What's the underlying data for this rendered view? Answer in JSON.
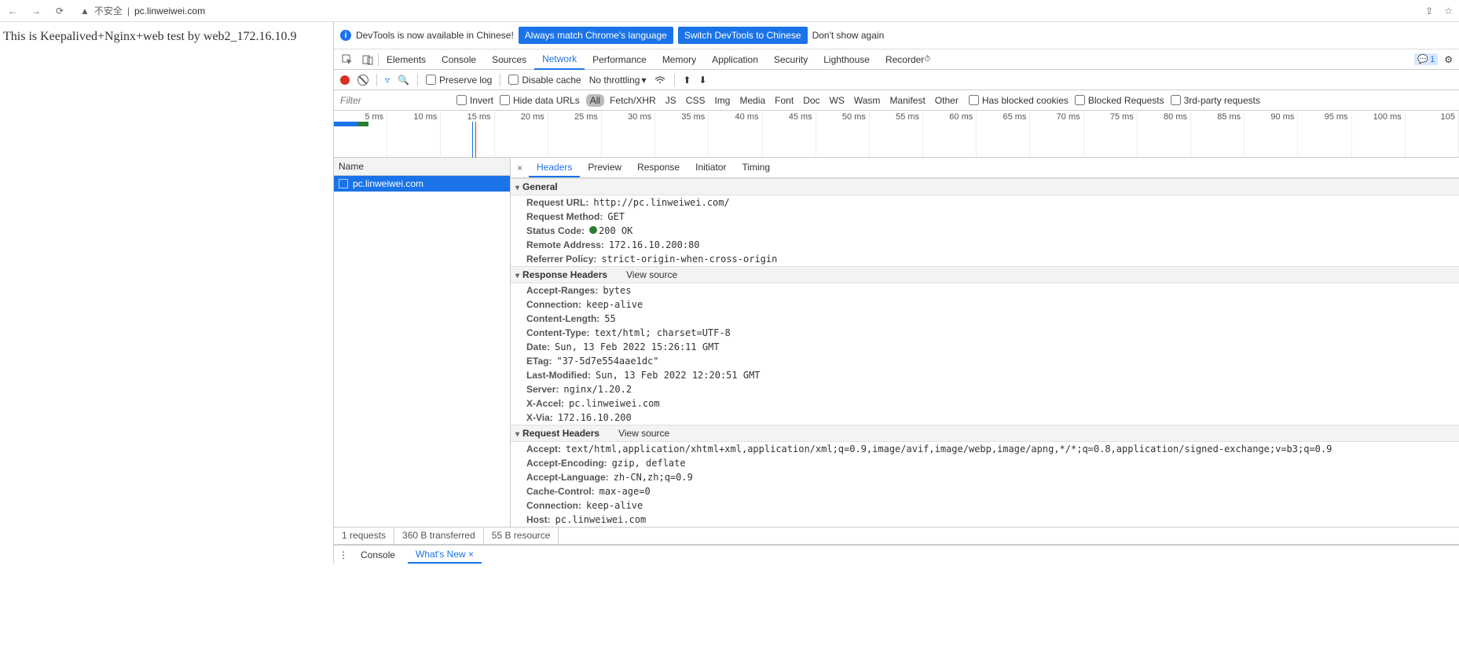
{
  "browser": {
    "insecure_label": "不安全",
    "url_display": "pc.linweiwei.com"
  },
  "page_content": "This is Keepalived+Nginx+web test by web2_172.16.10.9",
  "infobar": {
    "text": "DevTools is now available in Chinese!",
    "btn1": "Always match Chrome's language",
    "btn2": "Switch DevTools to Chinese",
    "link": "Don't show again"
  },
  "tabs": [
    "Elements",
    "Console",
    "Sources",
    "Network",
    "Performance",
    "Memory",
    "Application",
    "Security",
    "Lighthouse",
    "Recorder"
  ],
  "active_tab_index": 3,
  "messages_count": "1",
  "net_toolbar": {
    "preserve_log": "Preserve log",
    "disable_cache": "Disable cache",
    "throttling": "No throttling"
  },
  "filter": {
    "placeholder": "Filter",
    "invert": "Invert",
    "hide_data": "Hide data URLs",
    "types": [
      "All",
      "Fetch/XHR",
      "JS",
      "CSS",
      "Img",
      "Media",
      "Font",
      "Doc",
      "WS",
      "Wasm",
      "Manifest",
      "Other"
    ],
    "active_type_index": 0,
    "blocked_cookies": "Has blocked cookies",
    "blocked_requests": "Blocked Requests",
    "third_party": "3rd-party requests"
  },
  "timeline": [
    "5 ms",
    "10 ms",
    "15 ms",
    "20 ms",
    "25 ms",
    "30 ms",
    "35 ms",
    "40 ms",
    "45 ms",
    "50 ms",
    "55 ms",
    "60 ms",
    "65 ms",
    "70 ms",
    "75 ms",
    "80 ms",
    "85 ms",
    "90 ms",
    "95 ms",
    "100 ms",
    "105"
  ],
  "request_list": {
    "header": "Name",
    "items": [
      "pc.linweiwei.com"
    ]
  },
  "detail_tabs": [
    "Headers",
    "Preview",
    "Response",
    "Initiator",
    "Timing"
  ],
  "active_detail_index": 0,
  "sections": {
    "general_title": "General",
    "general": [
      {
        "k": "Request URL:",
        "v": "http://pc.linweiwei.com/"
      },
      {
        "k": "Request Method:",
        "v": "GET"
      },
      {
        "k": "Status Code:",
        "v": "200 OK",
        "status": true
      },
      {
        "k": "Remote Address:",
        "v": "172.16.10.200:80"
      },
      {
        "k": "Referrer Policy:",
        "v": "strict-origin-when-cross-origin"
      }
    ],
    "response_title": "Response Headers",
    "view_source": "View source",
    "response": [
      {
        "k": "Accept-Ranges:",
        "v": "bytes"
      },
      {
        "k": "Connection:",
        "v": "keep-alive"
      },
      {
        "k": "Content-Length:",
        "v": "55"
      },
      {
        "k": "Content-Type:",
        "v": "text/html; charset=UTF-8"
      },
      {
        "k": "Date:",
        "v": "Sun, 13 Feb 2022 15:26:11 GMT"
      },
      {
        "k": "ETag:",
        "v": "\"37-5d7e554aae1dc\""
      },
      {
        "k": "Last-Modified:",
        "v": "Sun, 13 Feb 2022 12:20:51 GMT"
      },
      {
        "k": "Server:",
        "v": "nginx/1.20.2"
      },
      {
        "k": "X-Accel:",
        "v": "pc.linweiwei.com"
      },
      {
        "k": "X-Via:",
        "v": "172.16.10.200"
      }
    ],
    "request_title": "Request Headers",
    "request": [
      {
        "k": "Accept:",
        "v": "text/html,application/xhtml+xml,application/xml;q=0.9,image/avif,image/webp,image/apng,*/*;q=0.8,application/signed-exchange;v=b3;q=0.9"
      },
      {
        "k": "Accept-Encoding:",
        "v": "gzip, deflate"
      },
      {
        "k": "Accept-Language:",
        "v": "zh-CN,zh;q=0.9"
      },
      {
        "k": "Cache-Control:",
        "v": "max-age=0"
      },
      {
        "k": "Connection:",
        "v": "keep-alive"
      },
      {
        "k": "Host:",
        "v": "pc.linweiwei.com"
      }
    ]
  },
  "status": [
    "1 requests",
    "360 B transferred",
    "55 B resource"
  ],
  "drawer": {
    "console": "Console",
    "whatsnew": "What's New"
  }
}
